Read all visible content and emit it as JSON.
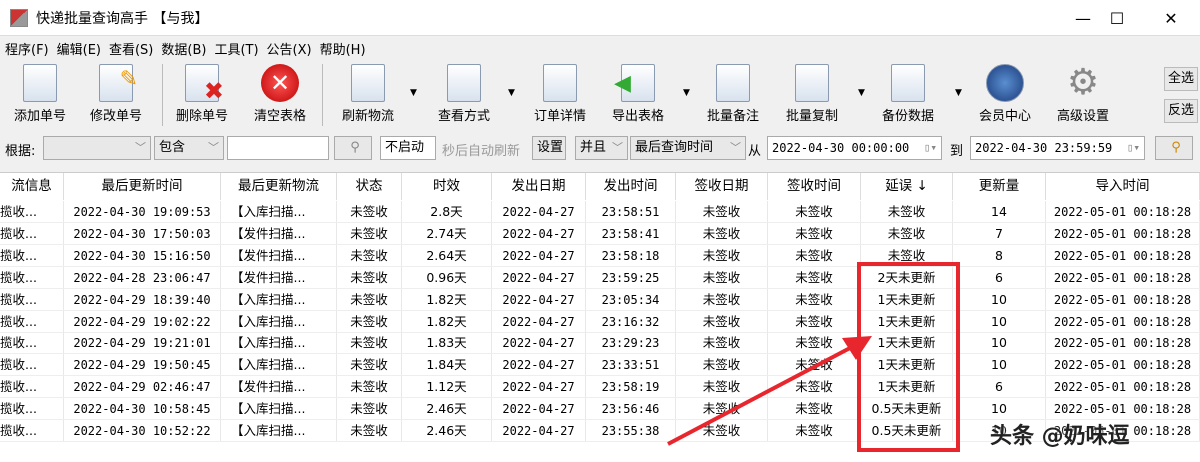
{
  "window": {
    "title": "快递批量查询高手 【与我】",
    "minimize": "—",
    "maximize": "☐",
    "close": "✕"
  },
  "menu": [
    "程序(F)",
    "编辑(E)",
    "查看(S)",
    "数据(B)",
    "工具(T)",
    "公告(X)",
    "帮助(H)"
  ],
  "toolbar": [
    "添加单号",
    "修改单号",
    "删除单号",
    "清空表格",
    "刷新物流",
    "查看方式",
    "订单详情",
    "导出表格",
    "批量备注",
    "批量复制",
    "备份数据",
    "会员中心",
    "高级设置"
  ],
  "side": {
    "select_all": "全选",
    "invert": "反选"
  },
  "filter": {
    "by_label": "根据:",
    "by_value": "",
    "match": "包含",
    "keyword": "",
    "auto": "不启动",
    "auto_text": "秒后自动刷新",
    "settings": "设置",
    "logic": "并且",
    "field": "最后查询时间",
    "from_label": "从",
    "from": "2022-04-30 00:00:00",
    "to_label": "到",
    "to": "2022-04-30 23:59:59"
  },
  "columns": [
    "流信息",
    "最后更新时间",
    "最后更新物流",
    "状态",
    "时效",
    "发出日期",
    "发出时间",
    "签收日期",
    "签收时间",
    "延误 ↓",
    "更新量",
    "导入时间"
  ],
  "rows": [
    [
      "揽收...",
      "2022-04-30 19:09:53",
      "【入库扫描...",
      "未签收",
      "2.8天",
      "2022-04-27",
      "23:58:51",
      "未签收",
      "未签收",
      "未签收",
      "14",
      "2022-05-01 00:18:28"
    ],
    [
      "揽收...",
      "2022-04-30 17:50:03",
      "【发件扫描...",
      "未签收",
      "2.74天",
      "2022-04-27",
      "23:58:41",
      "未签收",
      "未签收",
      "未签收",
      "7",
      "2022-05-01 00:18:28"
    ],
    [
      "揽收...",
      "2022-04-30 15:16:50",
      "【发件扫描...",
      "未签收",
      "2.64天",
      "2022-04-27",
      "23:58:18",
      "未签收",
      "未签收",
      "未签收",
      "8",
      "2022-05-01 00:18:28"
    ],
    [
      "揽收...",
      "2022-04-28 23:06:47",
      "【发件扫描...",
      "未签收",
      "0.96天",
      "2022-04-27",
      "23:59:25",
      "未签收",
      "未签收",
      "2天未更新",
      "6",
      "2022-05-01 00:18:28"
    ],
    [
      "揽收...",
      "2022-04-29 18:39:40",
      "【入库扫描...",
      "未签收",
      "1.82天",
      "2022-04-27",
      "23:05:34",
      "未签收",
      "未签收",
      "1天未更新",
      "10",
      "2022-05-01 00:18:28"
    ],
    [
      "揽收...",
      "2022-04-29 19:02:22",
      "【入库扫描...",
      "未签收",
      "1.82天",
      "2022-04-27",
      "23:16:32",
      "未签收",
      "未签收",
      "1天未更新",
      "10",
      "2022-05-01 00:18:28"
    ],
    [
      "揽收...",
      "2022-04-29 19:21:01",
      "【入库扫描...",
      "未签收",
      "1.83天",
      "2022-04-27",
      "23:29:23",
      "未签收",
      "未签收",
      "1天未更新",
      "10",
      "2022-05-01 00:18:28"
    ],
    [
      "揽收...",
      "2022-04-29 19:50:45",
      "【入库扫描...",
      "未签收",
      "1.84天",
      "2022-04-27",
      "23:33:51",
      "未签收",
      "未签收",
      "1天未更新",
      "10",
      "2022-05-01 00:18:28"
    ],
    [
      "揽收...",
      "2022-04-29 02:46:47",
      "【发件扫描...",
      "未签收",
      "1.12天",
      "2022-04-27",
      "23:58:19",
      "未签收",
      "未签收",
      "1天未更新",
      "6",
      "2022-05-01 00:18:28"
    ],
    [
      "揽收...",
      "2022-04-30 10:58:45",
      "【入库扫描...",
      "未签收",
      "2.46天",
      "2022-04-27",
      "23:56:46",
      "未签收",
      "未签收",
      "0.5天未更新",
      "10",
      "2022-05-01 00:18:28"
    ],
    [
      "揽收...",
      "2022-04-30 10:52:22",
      "【入库扫描...",
      "未签收",
      "2.46天",
      "2022-04-27",
      "23:55:38",
      "未签收",
      "未签收",
      "0.5天未更新",
      "10",
      "2022-05-01 00:18:28"
    ]
  ],
  "watermark": "头条 @奶味逗",
  "colors": {
    "highlight": "#e8262d"
  }
}
